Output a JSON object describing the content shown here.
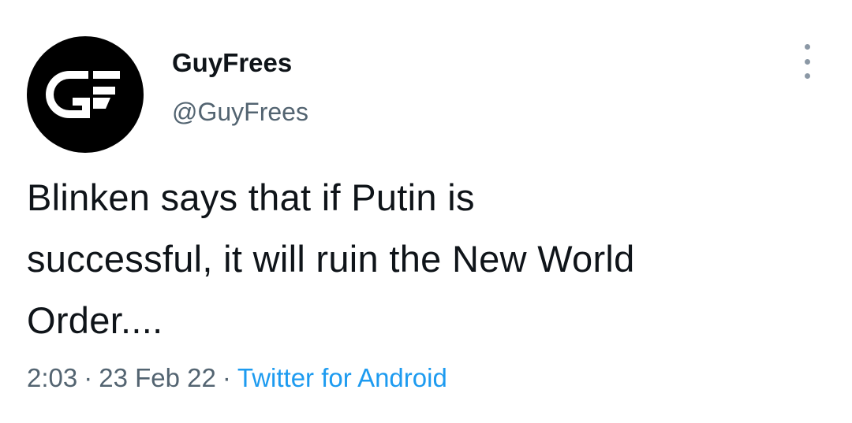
{
  "tweet": {
    "author": {
      "display_name": "GuyFrees",
      "handle": "@GuyFrees",
      "avatar_icon": "gf-logo-icon",
      "avatar_background": "#000000",
      "avatar_foreground": "#ffffff"
    },
    "more_icon": "more-vertical-icon",
    "text_lines": [
      "Blinken says that if Putin is",
      "successful, it will ruin the New World",
      "Order...."
    ],
    "meta": {
      "time": "2:03",
      "separator": "·",
      "date": "23 Feb 22",
      "source": "Twitter for Android"
    },
    "colors": {
      "text_primary": "#0f1419",
      "text_secondary": "#536471",
      "link": "#1d9bf0"
    }
  }
}
